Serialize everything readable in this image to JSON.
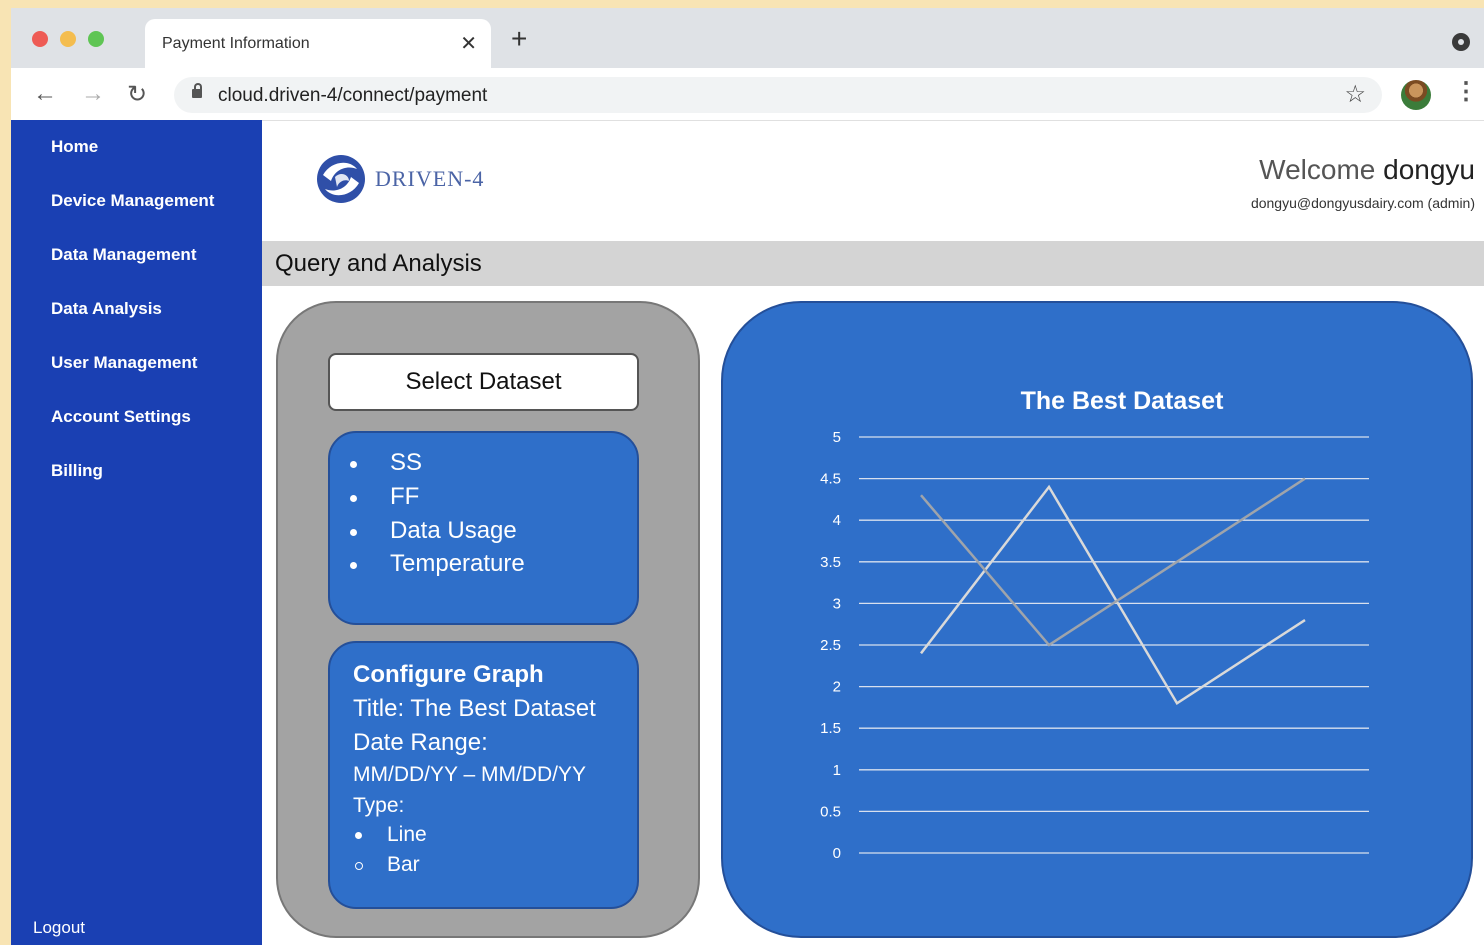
{
  "browser": {
    "tab_title": "Payment Information",
    "url": "cloud.driven-4/connect/payment"
  },
  "sidebar": {
    "items": [
      {
        "label": "Home"
      },
      {
        "label": "Device Management"
      },
      {
        "label": "Data Management"
      },
      {
        "label": "Data Analysis"
      },
      {
        "label": "User Management"
      },
      {
        "label": "Account Settings"
      },
      {
        "label": "Billing"
      }
    ],
    "logout": "Logout"
  },
  "header": {
    "logo_text": "DRIVEN-4",
    "welcome_prefix": "Welcome",
    "username": "dongyu",
    "email": "dongyu@dongyusdairy.com (admin)"
  },
  "section": {
    "title": "Query and Analysis"
  },
  "query": {
    "select_label": "Select Dataset",
    "datasets": [
      "SS",
      "FF",
      "Data Usage",
      "Temperature"
    ],
    "config": {
      "heading": "Configure Graph",
      "title_line": "Title: The Best Dataset",
      "date_label": "Date Range:",
      "date_value": "MM/DD/YY – MM/DD/YY",
      "type_label": "Type:",
      "types": [
        {
          "label": "Line",
          "selected": true
        },
        {
          "label": "Bar",
          "selected": false
        }
      ]
    }
  },
  "colors": {
    "sidebar": "#1a40b3",
    "panel_blue": "#2f6fc9",
    "series_a": "#d9d9d9",
    "series_b": "#9fa4ab"
  },
  "chart_data": {
    "type": "line",
    "title": "The Best Dataset",
    "x": [
      1,
      2,
      3,
      4
    ],
    "ylim": [
      0,
      5
    ],
    "yticks": [
      "0",
      "0.5",
      "1",
      "1.5",
      "2",
      "2.5",
      "3",
      "3.5",
      "4",
      "4.5",
      "5"
    ],
    "grid": true,
    "series": [
      {
        "values": [
          2.4,
          4.4,
          1.8,
          2.8
        ]
      },
      {
        "values": [
          4.3,
          2.5,
          3.5,
          4.5
        ]
      }
    ]
  }
}
